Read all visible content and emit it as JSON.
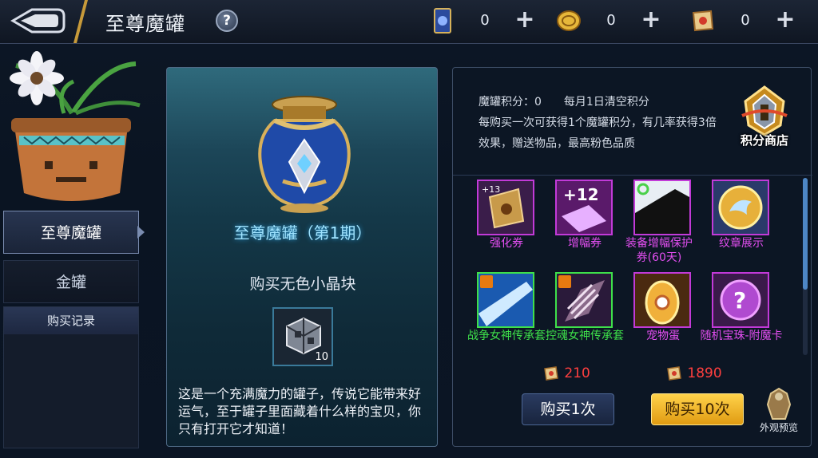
{
  "header": {
    "title": "至尊魔罐",
    "help": "?",
    "resources": [
      {
        "icon": "ticket-card-icon",
        "value": "0",
        "plus": "+"
      },
      {
        "icon": "gold-coin-icon",
        "value": "0",
        "plus": "+"
      },
      {
        "icon": "scroll-points-icon",
        "value": "0",
        "plus": "+"
      }
    ]
  },
  "left": {
    "tabs": [
      {
        "label": "至尊魔罐",
        "selected": true
      },
      {
        "label": "金罐",
        "selected": false
      }
    ],
    "history_title": "购买记录"
  },
  "center": {
    "jar_name": "至尊魔罐（第1期）",
    "buy_caption": "购买无色小晶块",
    "crystal_count": "10",
    "description": "这是一个充满魔力的罐子，传说它能带来好运气，至于罐子里面藏着什么样的宝贝，你只有打开它才知道！"
  },
  "right": {
    "points_label": "魔罐积分：0",
    "points_reset": "每月1日清空积分",
    "points_desc": "每购买一次可获得1个魔罐积分，有几率获得3倍效果，赠送物品，最高粉色品质",
    "shop_label": "积分商店",
    "items": [
      {
        "name": "强化券",
        "color": "#e24ef0",
        "badge": "+13"
      },
      {
        "name": "增幅券",
        "color": "#e24ef0",
        "badge": "+12"
      },
      {
        "name": "装备增幅保护券(60天)",
        "color": "#e24ef0",
        "badge": ""
      },
      {
        "name": "纹章展示",
        "color": "#e24ef0",
        "badge": ""
      },
      {
        "name": "战争女神传承套",
        "color": "#3ee04a",
        "badge": ""
      },
      {
        "name": "控魂女神传承套",
        "color": "#3ee04a",
        "badge": ""
      },
      {
        "name": "宠物蛋",
        "color": "#e24ef0",
        "badge": ""
      },
      {
        "name": "随机宝珠-附魔卡",
        "color": "#e24ef0",
        "badge": ""
      }
    ],
    "price_1": "210",
    "price_10": "1890",
    "buy1_label": "购买1次",
    "buy10_label": "购买10次",
    "preview_label": "外观预览"
  },
  "colors": {
    "accent_gold": "#e6a21a",
    "price_red": "#ff3f3f",
    "epic_pink": "#e24ef0",
    "set_green": "#3ee04a"
  }
}
